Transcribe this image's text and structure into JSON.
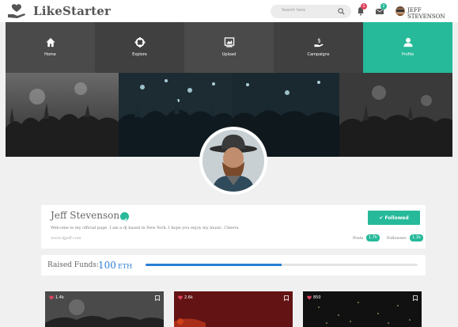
{
  "brand": {
    "name": "LikeStarter",
    "accent": "#26b99a",
    "link": "#2a7fd4"
  },
  "header": {
    "search_placeholder": "Search here",
    "notifications_count": "1",
    "messages_count": "2",
    "username": "JEFF STEVENSON"
  },
  "nav": {
    "items": [
      {
        "label": "Home",
        "icon": "home-icon"
      },
      {
        "label": "Explore",
        "icon": "explore-icon"
      },
      {
        "label": "Upload",
        "icon": "upload-icon"
      },
      {
        "label": "Campaigns",
        "icon": "campaigns-icon"
      },
      {
        "label": "Profile",
        "icon": "profile-icon",
        "active": true
      }
    ]
  },
  "profile": {
    "name": "Jeff Stevenson",
    "bio": "Welcome to my official page. I am a dj based in New York. I hope you enjoy my music. Cheers.",
    "website": "www.djjeff.com",
    "follow_label": "✔ Followed",
    "posts_label": "Posts",
    "posts_count": "1.7k",
    "followers_label": "Followers",
    "followers_count": "1.1k"
  },
  "funds": {
    "label": "Raised Funds:",
    "value": "100",
    "unit": "ETH",
    "progress_fraction": 0.5
  },
  "posts": [
    {
      "likes": "1.4k"
    },
    {
      "likes": "2.6k"
    },
    {
      "likes": "850"
    }
  ]
}
